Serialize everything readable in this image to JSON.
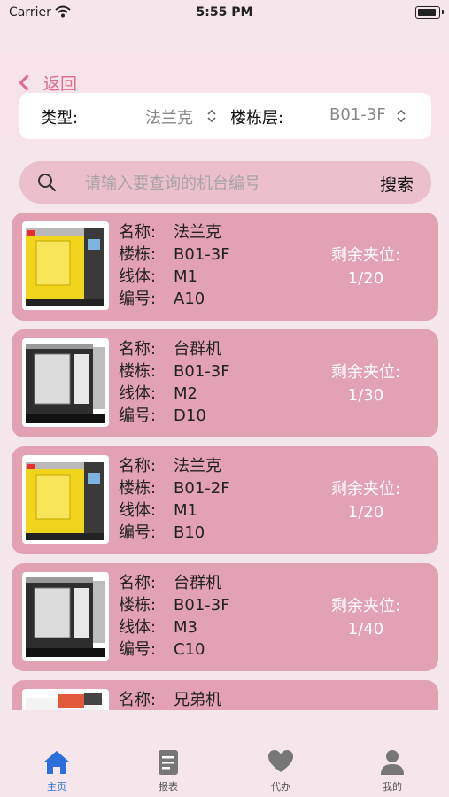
{
  "status_bar": {
    "carrier": "Carrier",
    "time": "5:55 PM"
  },
  "header": {
    "back_label": "返回"
  },
  "filter": {
    "type_label": "类型:",
    "type_value": "法兰克",
    "floor_label": "楼栋层:",
    "floor_value": "B01-3F"
  },
  "search": {
    "placeholder": "请输入要查询的机台编号",
    "button_label": "搜索"
  },
  "field_labels": {
    "name": "名称:",
    "building": "楼栋:",
    "line": "线体:",
    "number": "编号:",
    "slots": "剩余夹位:"
  },
  "machines": [
    {
      "name": "法兰克",
      "building": "B01-3F",
      "line": "M1",
      "number": "A10",
      "slots": "1/20",
      "image": "yellow-cnc-machine"
    },
    {
      "name": "台群机",
      "building": "B01-3F",
      "line": "M2",
      "number": "D10",
      "slots": "1/30",
      "image": "grey-cnc-machine"
    },
    {
      "name": "法兰克",
      "building": "B01-2F",
      "line": "M1",
      "number": "B10",
      "slots": "1/20",
      "image": "yellow-cnc-machine"
    },
    {
      "name": "台群机",
      "building": "B01-3F",
      "line": "M3",
      "number": "C10",
      "slots": "1/40",
      "image": "grey-cnc-machine"
    },
    {
      "name": "兄弟机",
      "building": "",
      "line": "",
      "number": "",
      "slots": "",
      "image": "white-cnc-machine"
    }
  ],
  "tabs": [
    {
      "label": "主页",
      "icon": "home-icon",
      "active": true
    },
    {
      "label": "报表",
      "icon": "report-icon",
      "active": false
    },
    {
      "label": "代办",
      "icon": "heart-icon",
      "active": false
    },
    {
      "label": "我的",
      "icon": "user-icon",
      "active": false
    }
  ],
  "colors": {
    "accent": "#e06b8b",
    "card": "#e3a1b4",
    "search": "#ebbfcc",
    "tab_active": "#2a6fdb",
    "background": "#f5e6eb"
  }
}
